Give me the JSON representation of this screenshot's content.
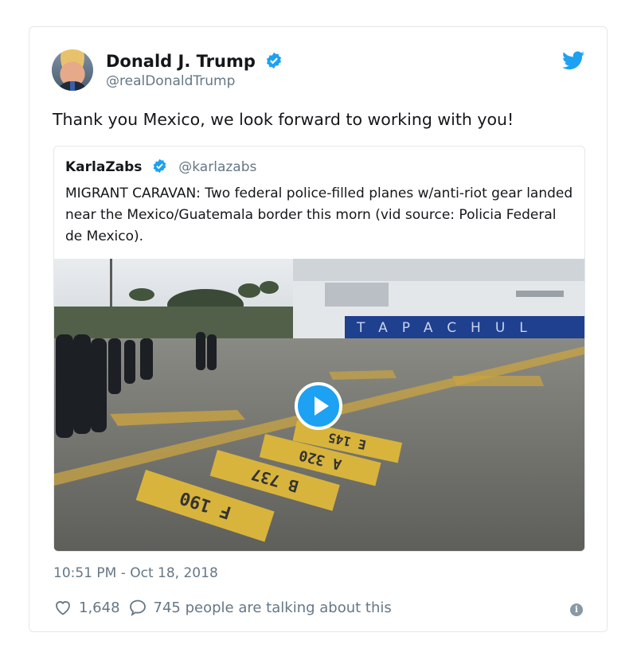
{
  "tweet": {
    "author_name": "Donald J. Trump",
    "author_handle": "@realDonaldTrump",
    "text": "Thank you Mexico, we look forward to working with you!",
    "timestamp": "10:51 PM - Oct 18, 2018",
    "likes": "1,648",
    "talking": "745 people are talking about this",
    "icons": [
      "avatar",
      "verified-badge-icon",
      "twitter-bird-icon",
      "heart-icon",
      "comment-icon",
      "info-icon"
    ],
    "accent_color": "#1da1f2"
  },
  "quoted": {
    "author_name": "KarlaZabs",
    "author_handle": "@karlazabs",
    "text": "MIGRANT CARAVAN: Two federal police-filled planes w/anti-riot gear landed near the Mexico/Guatemala border this morn (vid source: Policia Federal de Mexico).",
    "video_sign_text": "TAPACHUL",
    "tarmac_labels": [
      "F 190",
      "B 737",
      "A 320",
      "E 145"
    ]
  }
}
